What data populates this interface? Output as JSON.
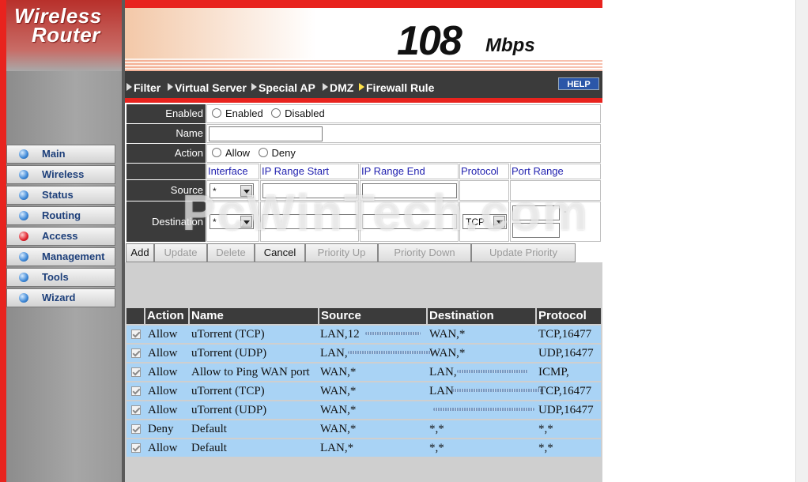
{
  "brand": {
    "line1": "Wireless",
    "line2": "Router"
  },
  "banner": {
    "speed": "108",
    "unit": "Mbps"
  },
  "sidebar": {
    "items": [
      {
        "label": "Main",
        "active": false
      },
      {
        "label": "Wireless",
        "active": false
      },
      {
        "label": "Status",
        "active": false
      },
      {
        "label": "Routing",
        "active": false
      },
      {
        "label": "Access",
        "active": true
      },
      {
        "label": "Management",
        "active": false
      },
      {
        "label": "Tools",
        "active": false
      },
      {
        "label": "Wizard",
        "active": false
      }
    ]
  },
  "tabs": [
    "Filter",
    "Virtual Server",
    "Special AP",
    "DMZ",
    "Firewall Rule"
  ],
  "help_label": "HELP",
  "form": {
    "enabled_label": "Enabled",
    "enabled_opt": "Enabled",
    "disabled_opt": "Disabled",
    "name_label": "Name",
    "action_label": "Action",
    "allow_opt": "Allow",
    "deny_opt": "Deny",
    "col_interface": "Interface",
    "col_ip_start": "IP Range Start",
    "col_ip_end": "IP Range End",
    "col_protocol": "Protocol",
    "col_port_range": "Port Range",
    "source_label": "Source",
    "destination_label": "Destination",
    "source_iface": "*",
    "dest_iface": "*",
    "dest_protocol": "TCP",
    "port_sep": "-"
  },
  "buttons": {
    "add": "Add",
    "update": "Update",
    "delete": "Delete",
    "cancel": "Cancel",
    "priority_up": "Priority Up",
    "priority_down": "Priority Down",
    "update_priority": "Update Priority"
  },
  "rules_table": {
    "headers": [
      "Action",
      "Name",
      "Source",
      "Destination",
      "Protocol"
    ],
    "rows": [
      {
        "action": "Allow",
        "name": "uTorrent (TCP)",
        "source": "LAN,12",
        "destination": "WAN,*",
        "protocol": "TCP,16477"
      },
      {
        "action": "Allow",
        "name": "uTorrent (UDP)",
        "source": "LAN,",
        "destination": "WAN,*",
        "protocol": "UDP,16477"
      },
      {
        "action": "Allow",
        "name": "Allow to Ping WAN port",
        "source": "WAN,*",
        "destination": "LAN,",
        "protocol": "ICMP,"
      },
      {
        "action": "Allow",
        "name": "uTorrent (TCP)",
        "source": "WAN,*",
        "destination": "LAN",
        "protocol": "TCP,16477"
      },
      {
        "action": "Allow",
        "name": "uTorrent (UDP)",
        "source": "WAN,*",
        "destination": "",
        "protocol": "UDP,16477"
      },
      {
        "action": "Deny",
        "name": "Default",
        "source": "WAN,*",
        "destination": "*,*",
        "protocol": "*,*"
      },
      {
        "action": "Allow",
        "name": "Default",
        "source": "LAN,*",
        "destination": "*,*",
        "protocol": "*,*"
      }
    ]
  },
  "watermark": "PcWinTech.com",
  "colors": {
    "accent_red": "#e8231e",
    "header_dark": "#3b3b3b",
    "row_blue": "#a9d3f5",
    "link_blue": "#2323b0"
  }
}
